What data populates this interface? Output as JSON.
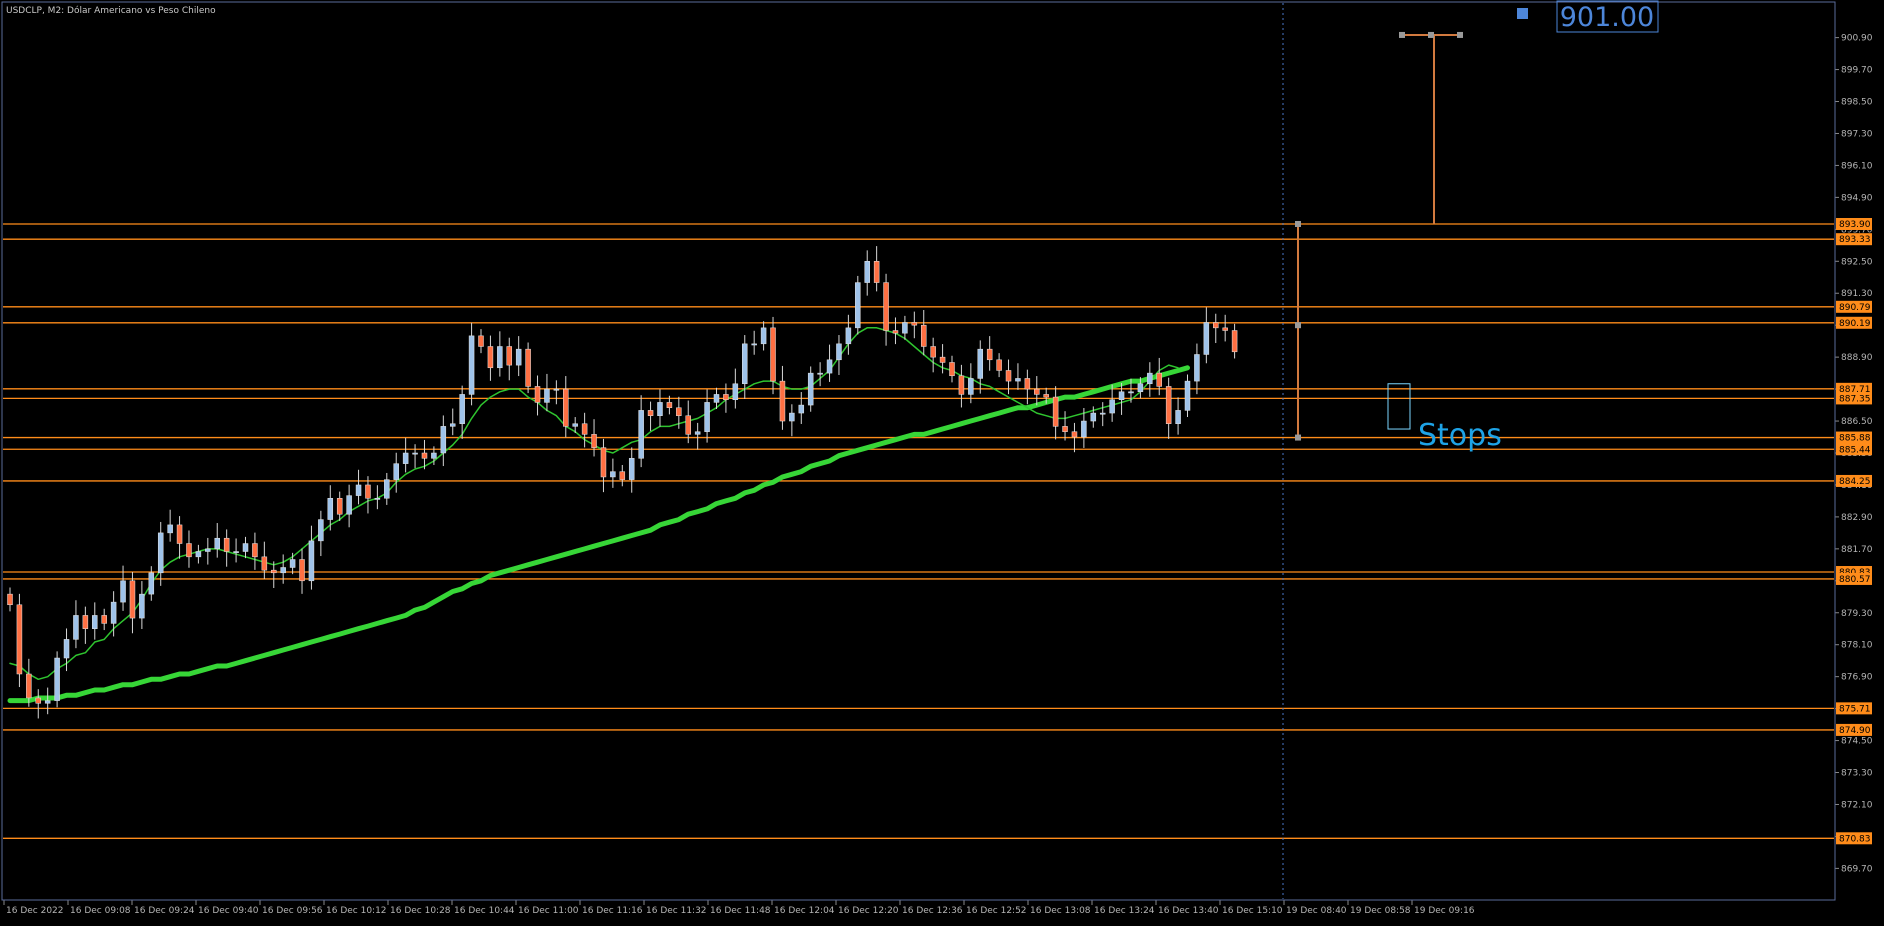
{
  "title": "USDCLP, M2:  Dólar Americano vs Peso Chileno",
  "price_label": "901.00",
  "annotation": "Stops",
  "colors": {
    "background": "#000000",
    "frame": "#5a6b9a",
    "axis_text": "#b4b4b4",
    "level_line": "#ff8c1a",
    "level_tag_bg": "#ff8c1a",
    "bull_candle": "#9fc3ea",
    "bear_candle": "#ff7043",
    "ma_fast": "#2fc42f",
    "ma_slow": "#37d637",
    "annotation": "#1ea3e6",
    "price_label": "#4d86d9",
    "measure_tool": "#d27a3f"
  },
  "chart_data": {
    "type": "candlestick",
    "symbol": "USDCLP",
    "timeframe": "M2",
    "y_range": [
      868.55,
      902.2
    ],
    "y_ticks": [
      "900.90",
      "899.70",
      "898.50",
      "897.30",
      "896.10",
      "894.90",
      "893.70",
      "892.50",
      "891.30",
      "890.10",
      "888.90",
      "887.70",
      "886.50",
      "885.30",
      "884.10",
      "882.90",
      "881.70",
      "880.50",
      "879.30",
      "878.10",
      "876.90",
      "875.70",
      "874.50",
      "873.30",
      "872.10",
      "870.90",
      "869.70"
    ],
    "x_labels": [
      "16 Dec 2022",
      "16 Dec 09:08",
      "16 Dec 09:24",
      "16 Dec 09:40",
      "16 Dec 09:56",
      "16 Dec 10:12",
      "16 Dec 10:28",
      "16 Dec 10:44",
      "16 Dec 11:00",
      "16 Dec 11:16",
      "16 Dec 11:32",
      "16 Dec 11:48",
      "16 Dec 12:04",
      "16 Dec 12:20",
      "16 Dec 12:36",
      "16 Dec 12:52",
      "16 Dec 13:08",
      "16 Dec 13:24",
      "16 Dec 13:40",
      "16 Dec 15:10",
      "19 Dec 08:40",
      "19 Dec 08:58",
      "19 Dec 09:16"
    ],
    "levels": [
      "893.90",
      "893.33",
      "890.79",
      "890.19",
      "887.71",
      "887.35",
      "885.88",
      "885.44",
      "884.25",
      "880.83",
      "880.57",
      "875.71",
      "874.90",
      "870.83"
    ],
    "closes": [
      879.6,
      877.0,
      876.1,
      875.9,
      876.0,
      877.6,
      878.3,
      879.2,
      878.7,
      879.2,
      878.9,
      879.7,
      880.5,
      879.1,
      880.0,
      880.8,
      882.3,
      882.6,
      881.9,
      881.4,
      881.6,
      881.7,
      882.1,
      881.6,
      881.6,
      881.9,
      881.4,
      880.9,
      880.8,
      881.0,
      881.3,
      880.5,
      882.0,
      882.8,
      883.6,
      883.0,
      883.7,
      884.1,
      883.6,
      883.6,
      884.3,
      884.9,
      885.3,
      885.3,
      885.1,
      885.3,
      886.3,
      886.4,
      887.5,
      889.7,
      889.3,
      888.5,
      889.3,
      888.6,
      889.2,
      887.8,
      887.2,
      887.7,
      887.7,
      886.3,
      886.4,
      886.0,
      885.5,
      884.4,
      884.6,
      884.3,
      885.1,
      886.9,
      886.7,
      887.2,
      887.0,
      886.7,
      886.0,
      886.1,
      887.2,
      887.5,
      887.3,
      887.9,
      889.4,
      889.4,
      890.0,
      888.0,
      886.5,
      886.8,
      887.1,
      888.3,
      888.3,
      888.8,
      889.4,
      890.0,
      891.7,
      892.5,
      891.7,
      889.9,
      889.8,
      890.2,
      890.1,
      889.3,
      888.9,
      888.7,
      888.2,
      887.5,
      888.1,
      889.2,
      888.8,
      888.4,
      888.0,
      888.1,
      887.7,
      887.5,
      887.4,
      886.3,
      886.1,
      885.9,
      886.5,
      886.8,
      886.8,
      887.3,
      887.6,
      887.6,
      887.9,
      888.3,
      887.8,
      886.4,
      886.9,
      888.0,
      889.0,
      890.2,
      890.0,
      889.9,
      889.1
    ],
    "ma_fast": [
      877.4,
      877.3,
      877.0,
      876.8,
      876.9,
      877.2,
      877.4,
      877.7,
      877.8,
      878.2,
      878.3,
      878.7,
      879.0,
      879.3,
      879.8,
      880.4,
      880.9,
      881.2,
      881.4,
      881.5,
      881.6,
      881.7,
      881.7,
      881.6,
      881.5,
      881.4,
      881.3,
      881.2,
      881.1,
      881.2,
      881.4,
      881.7,
      882.0,
      882.3,
      882.6,
      882.8,
      883.1,
      883.3,
      883.5,
      883.6,
      883.8,
      884.2,
      884.5,
      884.7,
      884.8,
      885.0,
      885.3,
      885.6,
      886.0,
      886.6,
      887.1,
      887.4,
      887.6,
      887.7,
      887.7,
      887.4,
      887.2,
      886.9,
      886.7,
      886.3,
      886.1,
      885.8,
      885.6,
      885.4,
      885.3,
      885.5,
      885.7,
      885.8,
      886.1,
      886.3,
      886.3,
      886.4,
      886.5,
      886.6,
      886.8,
      887.0,
      887.3,
      887.5,
      887.7,
      887.9,
      888.0,
      888.0,
      887.8,
      887.7,
      887.7,
      887.8,
      888.1,
      888.4,
      888.9,
      889.4,
      889.8,
      890.0,
      890.0,
      889.9,
      889.8,
      889.6,
      889.3,
      889.0,
      888.7,
      888.5,
      888.4,
      888.2,
      888.1,
      887.9,
      887.8,
      887.6,
      887.4,
      887.2,
      887.0,
      886.8,
      886.7,
      886.6,
      886.6,
      886.7,
      886.8,
      886.9,
      887.0,
      887.1,
      887.2,
      887.3,
      887.6,
      888.0,
      888.4,
      888.6,
      888.5
    ],
    "ma_slow": [
      876.0,
      876.0,
      876.0,
      876.1,
      876.1,
      876.1,
      876.2,
      876.2,
      876.3,
      876.4,
      876.4,
      876.5,
      876.6,
      876.6,
      876.7,
      876.8,
      876.8,
      876.9,
      877.0,
      877.0,
      877.1,
      877.2,
      877.3,
      877.3,
      877.4,
      877.5,
      877.6,
      877.7,
      877.8,
      877.9,
      878.0,
      878.1,
      878.2,
      878.3,
      878.4,
      878.5,
      878.6,
      878.7,
      878.8,
      878.9,
      879.0,
      879.1,
      879.2,
      879.4,
      879.5,
      879.7,
      879.9,
      880.1,
      880.2,
      880.4,
      880.5,
      880.7,
      880.8,
      880.9,
      881.0,
      881.1,
      881.2,
      881.3,
      881.4,
      881.5,
      881.6,
      881.7,
      881.8,
      881.9,
      882.0,
      882.1,
      882.2,
      882.3,
      882.4,
      882.6,
      882.7,
      882.8,
      883.0,
      883.1,
      883.2,
      883.4,
      883.5,
      883.6,
      883.8,
      883.9,
      884.1,
      884.2,
      884.4,
      884.5,
      884.6,
      884.8,
      884.9,
      885.0,
      885.2,
      885.3,
      885.4,
      885.5,
      885.6,
      885.7,
      885.8,
      885.9,
      886.0,
      886.0,
      886.1,
      886.2,
      886.3,
      886.4,
      886.5,
      886.6,
      886.7,
      886.8,
      886.9,
      887.0,
      887.0,
      887.1,
      887.2,
      887.3,
      887.4,
      887.4,
      887.5,
      887.6,
      887.7,
      887.8,
      887.9,
      888.0,
      888.0,
      888.1,
      888.2,
      888.3,
      888.4,
      888.5
    ],
    "measure_tool": {
      "vertical_line_date": "19 Dec 08:40",
      "segment_a": [
        885.88,
        893.9
      ],
      "segment_b_top": 901.0,
      "segment_b_bottom": 893.9,
      "mid_marker": 890.1
    }
  }
}
